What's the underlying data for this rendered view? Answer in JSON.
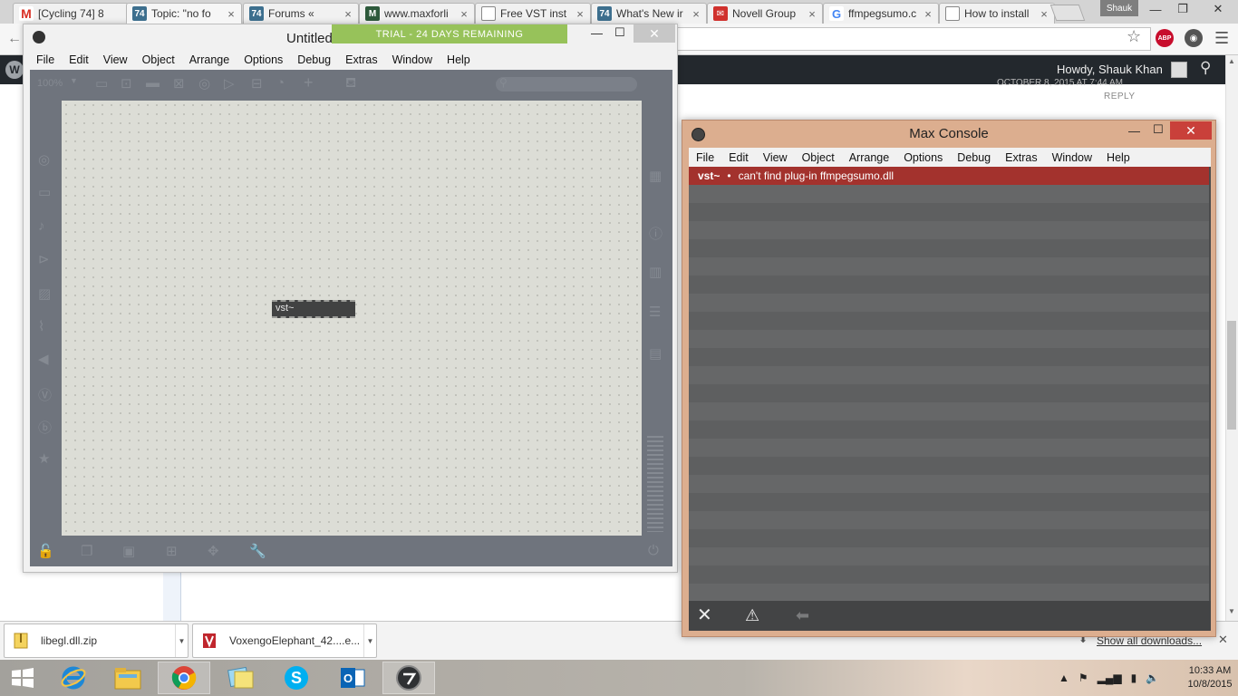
{
  "browser": {
    "tabs": [
      {
        "label": "[Cycling 74] 8",
        "icon": "gmail-icon"
      },
      {
        "label": "Topic: \"no fo",
        "icon": "cycling74-icon",
        "active": true
      },
      {
        "label": "Forums «",
        "icon": "cycling74-icon"
      },
      {
        "label": "www.maxforli",
        "icon": "maxforlive-icon"
      },
      {
        "label": "Free VST inst",
        "icon": "document-icon"
      },
      {
        "label": "What's New ir",
        "icon": "cycling74-icon"
      },
      {
        "label": "Novell Group",
        "icon": "mail-icon"
      },
      {
        "label": "ffmpegsumo.c",
        "icon": "google-icon"
      },
      {
        "label": "How to install",
        "icon": "document-icon"
      }
    ],
    "profile_name": "Shauk",
    "toolbar": {
      "adblock_label": "ABP"
    }
  },
  "page": {
    "admin_bar": {
      "greeting": "Howdy, Shauk Khan"
    },
    "reply_label": "REPLY",
    "date_text": "OCTOBER 8, 2015 AT 7:44 AM"
  },
  "downloads": {
    "items": [
      {
        "name": "libegl.dll.zip"
      },
      {
        "name": "VoxengoElephant_42....e..."
      }
    ],
    "show_all_label": "Show all downloads..."
  },
  "max_patcher": {
    "title": "Untitled",
    "trial_banner": "TRIAL - 24 DAYS REMAINING",
    "zoom": "100%",
    "menu": [
      "File",
      "Edit",
      "View",
      "Object",
      "Arrange",
      "Options",
      "Debug",
      "Extras",
      "Window",
      "Help"
    ],
    "object_text": "vst~"
  },
  "max_console": {
    "title": "Max Console",
    "menu": [
      "File",
      "Edit",
      "View",
      "Object",
      "Arrange",
      "Options",
      "Debug",
      "Extras",
      "Window",
      "Help"
    ],
    "messages": [
      {
        "object": "vst~",
        "bullet": "•",
        "text": "can't find plug-in ffmpegsumo.dll",
        "level": "error"
      }
    ]
  },
  "taskbar": {
    "pinned": [
      "file-explorer",
      "internet-explorer",
      "file-explorer",
      "chrome",
      "windows-photos",
      "skype",
      "outlook",
      "max"
    ],
    "clock": {
      "time": "10:33 AM",
      "date": "10/8/2015"
    }
  },
  "colors": {
    "console_error": "#a3322d",
    "trial_banner": "#97c25a",
    "wp_admin_bar": "#23282d",
    "patcher_canvas": "#dcddd6"
  }
}
